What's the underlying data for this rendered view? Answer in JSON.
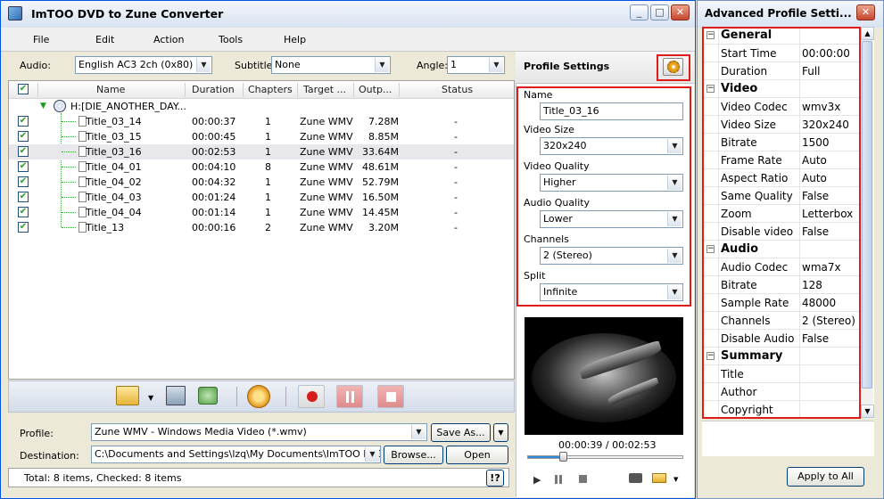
{
  "main_window": {
    "title": "ImTOO DVD to Zune Converter",
    "menu": [
      "File",
      "Edit",
      "Action",
      "Tools",
      "Help"
    ],
    "audio_label": "Audio:",
    "audio_value": "English AC3 2ch (0x80)",
    "subtitle_label": "Subtitle:",
    "subtitle_value": "None",
    "angle_label": "Angle:",
    "angle_value": "1",
    "columns": [
      "Name",
      "Duration",
      "Chapters",
      "Target ...",
      "Outp...",
      "Status"
    ],
    "root_item": "H:[DIE_ANOTHER_DAY...",
    "rows": [
      {
        "name": "Title_03_14",
        "duration": "00:00:37",
        "chapters": "1",
        "target": "Zune WMV",
        "output": "7.28M",
        "status": "-"
      },
      {
        "name": "Title_03_15",
        "duration": "00:00:45",
        "chapters": "1",
        "target": "Zune WMV",
        "output": "8.85M",
        "status": "-"
      },
      {
        "name": "Title_03_16",
        "duration": "00:02:53",
        "chapters": "1",
        "target": "Zune WMV",
        "output": "33.64M",
        "status": "-"
      },
      {
        "name": "Title_04_01",
        "duration": "00:04:10",
        "chapters": "8",
        "target": "Zune WMV",
        "output": "48.61M",
        "status": "-"
      },
      {
        "name": "Title_04_02",
        "duration": "00:04:32",
        "chapters": "1",
        "target": "Zune WMV",
        "output": "52.79M",
        "status": "-"
      },
      {
        "name": "Title_04_03",
        "duration": "00:01:24",
        "chapters": "1",
        "target": "Zune WMV",
        "output": "16.50M",
        "status": "-"
      },
      {
        "name": "Title_04_04",
        "duration": "00:01:14",
        "chapters": "1",
        "target": "Zune WMV",
        "output": "14.45M",
        "status": "-"
      },
      {
        "name": "Title_13",
        "duration": "00:00:16",
        "chapters": "2",
        "target": "Zune WMV",
        "output": "3.20M",
        "status": "-"
      }
    ],
    "profile_label": "Profile:",
    "profile_value": "Zune WMV - Windows Media Video  (*.wmv)",
    "save_as_label": "Save As...",
    "destination_label": "Destination:",
    "destination_value": "C:\\Documents and Settings\\lzq\\My Documents\\ImTOO DVD to Z",
    "browse_label": "Browse...",
    "open_label": "Open",
    "status_text": "Total: 8 items, Checked: 8 items",
    "help_label": "!?"
  },
  "profile_settings": {
    "title": "Profile Settings",
    "name_label": "Name",
    "name_value": "Title_03_16",
    "video_size_label": "Video Size",
    "video_size_value": "320x240",
    "video_quality_label": "Video Quality",
    "video_quality_value": "Higher",
    "audio_quality_label": "Audio Quality",
    "audio_quality_value": "Lower",
    "channels_label": "Channels",
    "channels_value": "2 (Stereo)",
    "split_label": "Split",
    "split_value": "Infinite",
    "time_readout": "00:00:39 / 00:02:53",
    "playback_progress": 0.225
  },
  "advanced_panel": {
    "title": "Advanced Profile Setti...",
    "apply_label": "Apply to All",
    "groups": [
      {
        "name": "General",
        "items": [
          [
            "Start Time",
            "00:00:00"
          ],
          [
            "Duration",
            "Full"
          ]
        ]
      },
      {
        "name": "Video",
        "items": [
          [
            "Video Codec",
            "wmv3x"
          ],
          [
            "Video Size",
            "320x240"
          ],
          [
            "Bitrate",
            "1500"
          ],
          [
            "Frame Rate",
            "Auto"
          ],
          [
            "Aspect Ratio",
            "Auto"
          ],
          [
            "Same Quality",
            "False"
          ],
          [
            "Zoom",
            "Letterbox"
          ],
          [
            "Disable video",
            "False"
          ]
        ]
      },
      {
        "name": "Audio",
        "items": [
          [
            "Audio Codec",
            "wma7x"
          ],
          [
            "Bitrate",
            "128"
          ],
          [
            "Sample Rate",
            "48000"
          ],
          [
            "Channels",
            "2 (Stereo)"
          ],
          [
            "Disable Audio",
            "False"
          ]
        ]
      },
      {
        "name": "Summary",
        "items": [
          [
            "Title",
            ""
          ],
          [
            "Author",
            ""
          ],
          [
            "Copyright",
            ""
          ]
        ]
      }
    ]
  }
}
